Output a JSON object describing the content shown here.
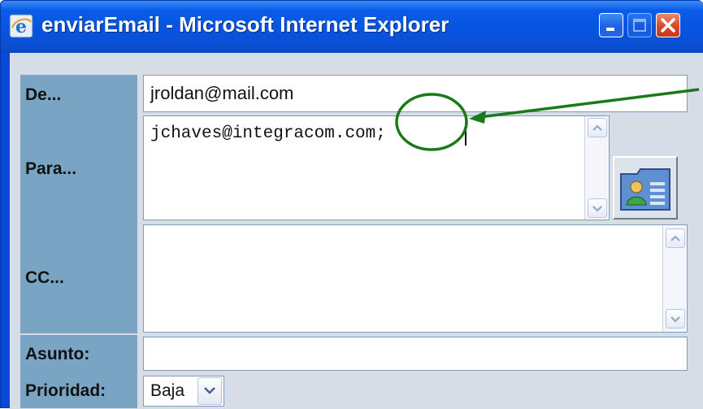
{
  "window": {
    "title": "enviarEmail - Microsoft Internet Explorer"
  },
  "form": {
    "from_label": "De...",
    "from_value": "jroldan@mail.com",
    "to_label": "Para...",
    "to_value": "jchaves@integracom.com;",
    "cc_label": "CC...",
    "cc_value": "",
    "subject_label": "Asunto:",
    "subject_value": "",
    "priority_label": "Prioridad:",
    "priority_value": "Baja"
  },
  "annotation": {
    "color": "#1a7a1a"
  },
  "icons": [
    "ie-icon",
    "minimize-icon",
    "maximize-icon",
    "close-icon",
    "address-book-icon",
    "chevron-up-icon",
    "chevron-down-icon"
  ]
}
